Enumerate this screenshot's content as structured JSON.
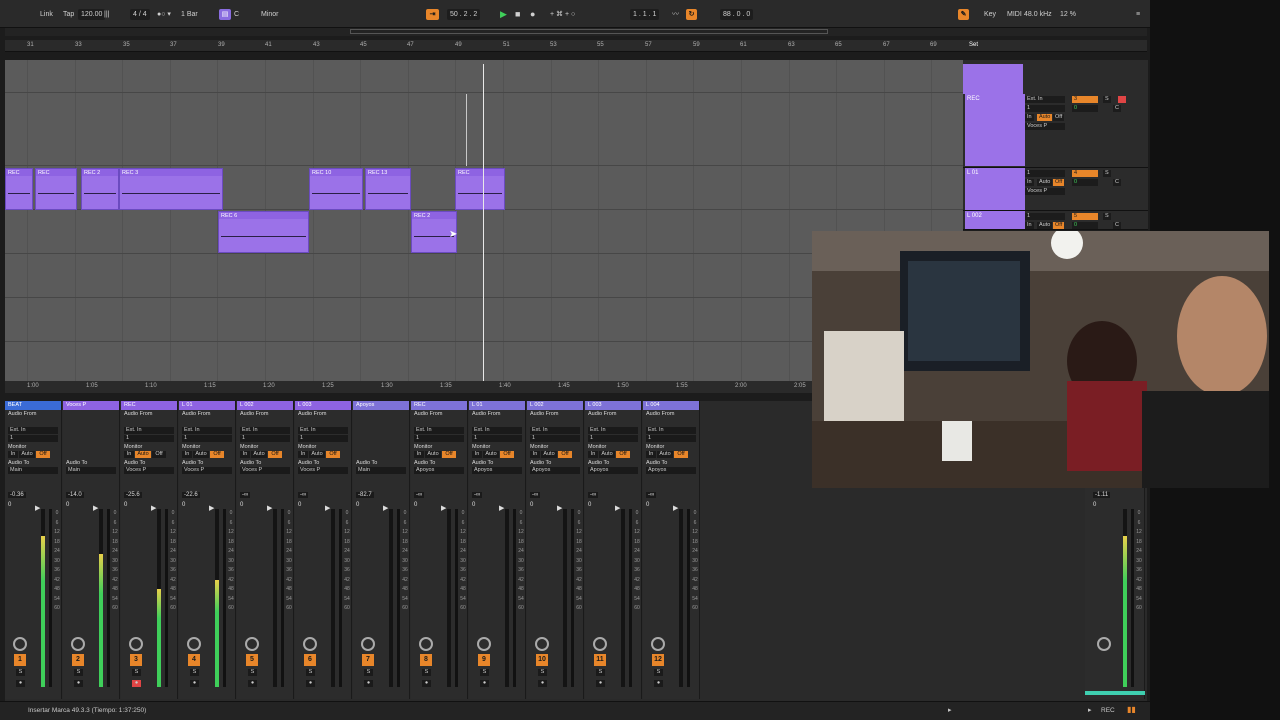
{
  "transport": {
    "link": "Link",
    "tap": "Tap",
    "tempo": "120.00",
    "signature": "4 / 4",
    "bar": "1 Bar",
    "key": "C",
    "scale": "Minor",
    "position": "50 . 2 . 2",
    "loop_start": "1 . 1 . 1",
    "loop_len": "88 . 0 . 0",
    "key_btn": "Key",
    "midi": "MIDI",
    "sample_rate": "48.0 kHz",
    "cpu": "12 %"
  },
  "ruler": {
    "ticks": [
      "31",
      "33",
      "35",
      "37",
      "39",
      "41",
      "43",
      "45",
      "47",
      "49",
      "51",
      "53",
      "55",
      "57",
      "59",
      "61",
      "63",
      "65",
      "67",
      "69"
    ],
    "set_label": "Set"
  },
  "timebar": {
    "labels": [
      "1:00",
      "1:05",
      "1:10",
      "1:15",
      "1:20",
      "1:25",
      "1:30",
      "1:35",
      "1:40",
      "1:45",
      "1:50",
      "1:55",
      "2:00",
      "2:05"
    ]
  },
  "clips": {
    "row1": [
      "REC",
      "REC",
      "REC 2",
      "REC 3",
      "REC 10",
      "REC 13",
      "REC"
    ],
    "row2": [
      "REC 6",
      "REC 2"
    ]
  },
  "track_headers": [
    {
      "name": "REC",
      "input": "Ext. In",
      "channel": "1",
      "in": "In",
      "auto": "Auto",
      "off": "Off",
      "route": "Voces P",
      "num": "3",
      "s": "S",
      "c": "C",
      "vol": "0"
    },
    {
      "name": "L 01",
      "input": "Ext. In",
      "channel": "1",
      "in": "In",
      "auto": "Auto",
      "off": "Off",
      "route": "Voces P",
      "num": "4",
      "s": "S",
      "c": "C",
      "vol": "0"
    },
    {
      "name": "L 002",
      "input": "Ext. In",
      "channel": "1",
      "in": "In",
      "auto": "Auto",
      "off": "Off",
      "route": "",
      "num": "5",
      "s": "S",
      "c": "C",
      "vol": "0"
    }
  ],
  "mixer": {
    "channels": [
      {
        "name": "BEAT",
        "color": "#3a6bd6",
        "from": "Audio From",
        "src": "Ext. In",
        "chan": "1",
        "monitor": "Monitor",
        "to": "Audio To",
        "dest": "Main",
        "vol": "-0.36",
        "pan": "0",
        "num": "1",
        "level": 0.85
      },
      {
        "name": "Voces P",
        "color": "#8e63e2",
        "from": "",
        "src": "",
        "chan": "",
        "monitor": "",
        "to": "Audio To",
        "dest": "Main",
        "vol": "-14.0",
        "pan": "0",
        "num": "2",
        "level": 0.75
      },
      {
        "name": "REC",
        "color": "#8e63e2",
        "from": "Audio From",
        "src": "Ext. In",
        "chan": "1",
        "monitor": "Monitor",
        "to": "Audio To",
        "dest": "Voces P",
        "vol": "-25.6",
        "pan": "0",
        "num": "3",
        "level": 0.55
      },
      {
        "name": "L 01",
        "color": "#8e63e2",
        "from": "Audio From",
        "src": "Ext. In",
        "chan": "1",
        "monitor": "Monitor",
        "to": "Audio To",
        "dest": "Voces P",
        "vol": "-22.6",
        "pan": "0",
        "num": "4",
        "level": 0.6
      },
      {
        "name": "L 002",
        "color": "#8e63e2",
        "from": "Audio From",
        "src": "Ext. In",
        "chan": "1",
        "monitor": "Monitor",
        "to": "Audio To",
        "dest": "Voces P",
        "vol": "-∞",
        "pan": "0",
        "num": "5",
        "level": 0
      },
      {
        "name": "L 003",
        "color": "#8e63e2",
        "from": "Audio From",
        "src": "Ext. In",
        "chan": "1",
        "monitor": "Monitor",
        "to": "Audio To",
        "dest": "Voces P",
        "vol": "-∞",
        "pan": "0",
        "num": "6",
        "level": 0
      },
      {
        "name": "Apoyos",
        "color": "#7e72d8",
        "from": "",
        "src": "",
        "chan": "",
        "monitor": "",
        "to": "Audio To",
        "dest": "Main",
        "vol": "-82.7",
        "pan": "0",
        "num": "7",
        "level": 0
      },
      {
        "name": "REC",
        "color": "#7e72d8",
        "from": "Audio From",
        "src": "Ext. In",
        "chan": "1",
        "monitor": "Monitor",
        "to": "Audio To",
        "dest": "Apoyos",
        "vol": "-∞",
        "pan": "0",
        "num": "8",
        "level": 0
      },
      {
        "name": "L 01",
        "color": "#7e72d8",
        "from": "Audio From",
        "src": "Ext. In",
        "chan": "1",
        "monitor": "Monitor",
        "to": "Audio To",
        "dest": "Apoyos",
        "vol": "-∞",
        "pan": "0",
        "num": "9",
        "level": 0
      },
      {
        "name": "L 002",
        "color": "#7e72d8",
        "from": "Audio From",
        "src": "Ext. In",
        "chan": "1",
        "monitor": "Monitor",
        "to": "Audio To",
        "dest": "Apoyos",
        "vol": "-∞",
        "pan": "0",
        "num": "10",
        "level": 0
      },
      {
        "name": "L 003",
        "color": "#7e72d8",
        "from": "Audio From",
        "src": "Ext. In",
        "chan": "1",
        "monitor": "Monitor",
        "to": "Audio To",
        "dest": "Apoyos",
        "vol": "-∞",
        "pan": "0",
        "num": "11",
        "level": 0
      },
      {
        "name": "L 004",
        "color": "#7e72d8",
        "from": "Audio From",
        "src": "Ext. In",
        "chan": "1",
        "monitor": "Monitor",
        "to": "Audio To",
        "dest": "Apoyos",
        "vol": "-∞",
        "pan": "0",
        "num": "12",
        "level": 0
      }
    ],
    "master": {
      "vol": "-1.11",
      "pan": "0",
      "level": 0.85
    },
    "mon_in": "In",
    "mon_auto": "Auto",
    "mon_off": "Off",
    "s": "S",
    "scale": [
      "0",
      "6",
      "12",
      "18",
      "24",
      "30",
      "36",
      "42",
      "48",
      "54",
      "60"
    ]
  },
  "status": {
    "text": "Insertar Marca 49.3.3 (Tiempo: 1:37:250)",
    "rec": "REC"
  }
}
